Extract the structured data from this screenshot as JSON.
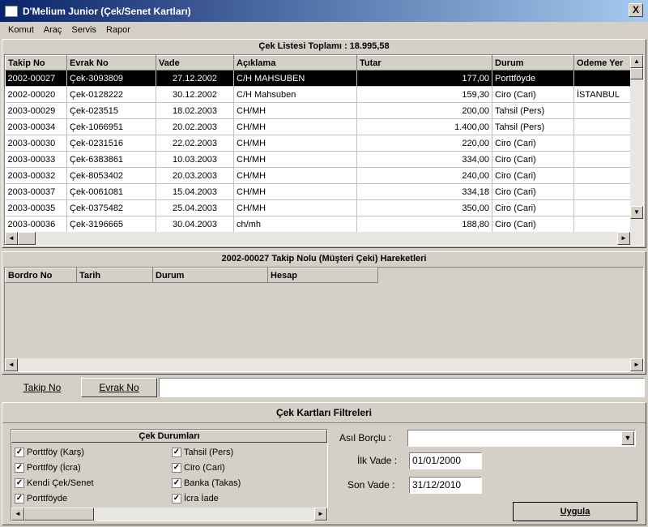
{
  "window": {
    "title": "D'Melium Junior (Çek/Senet Kartları)",
    "close": "X"
  },
  "menu": [
    "Komut",
    "Araç",
    "Servis",
    "Rapor"
  ],
  "list": {
    "title": "Çek Listesi Toplamı : 18.995,58",
    "columns": [
      "Takip No",
      "Evrak No",
      "Vade",
      "Açıklama",
      "Tutar",
      "Durum",
      "Odeme Yer"
    ],
    "rows": [
      [
        "2002-00027",
        "Çek-3093809",
        "27.12.2002",
        "C/H MAHSUBEN",
        "177,00",
        "Porttföyde",
        ""
      ],
      [
        "2002-00020",
        "Çek-0128222",
        "30.12.2002",
        "C/H Mahsuben",
        "159,30",
        "Ciro (Cari)",
        "İSTANBUL"
      ],
      [
        "2003-00029",
        "Çek-023515",
        "18.02.2003",
        "CH/MH",
        "200,00",
        "Tahsil (Pers)",
        ""
      ],
      [
        "2003-00034",
        "Çek-1066951",
        "20.02.2003",
        "CH/MH",
        "1.400,00",
        "Tahsil (Pers)",
        ""
      ],
      [
        "2003-00030",
        "Çek-0231516",
        "22.02.2003",
        "CH/MH",
        "220,00",
        "Ciro (Cari)",
        ""
      ],
      [
        "2003-00033",
        "Çek-6383861",
        "10.03.2003",
        "CH/MH",
        "334,00",
        "Ciro (Cari)",
        ""
      ],
      [
        "2003-00032",
        "Çek-8053402",
        "20.03.2003",
        "CH/MH",
        "240,00",
        "Ciro (Cari)",
        ""
      ],
      [
        "2003-00037",
        "Çek-0061081",
        "15.04.2003",
        "CH/MH",
        "334,18",
        "Ciro (Cari)",
        ""
      ],
      [
        "2003-00035",
        "Çek-0375482",
        "25.04.2003",
        "CH/MH",
        "350,00",
        "Ciro (Cari)",
        ""
      ],
      [
        "2003-00036",
        "Çek-3196665",
        "30.04.2003",
        "ch/mh",
        "188,80",
        "Ciro (Cari)",
        ""
      ]
    ]
  },
  "movements": {
    "title": "2002-00027 Takip Nolu (Müşteri Çeki) Hareketleri",
    "columns": [
      "Bordro No",
      "Tarih",
      "Durum",
      "Hesap"
    ]
  },
  "search": {
    "tab1": "Takip No",
    "tab2": "Evrak No",
    "value": ""
  },
  "filters": {
    "title": "Çek Kartları Filtreleri",
    "status_title": "Çek Durumları",
    "statuses_left": [
      "Porttföy (Karş)",
      "Porttföy (İcra)",
      "Kendi Çek/Senet",
      "Porttföyde"
    ],
    "statuses_right": [
      "Tahsil (Pers)",
      "Ciro (Cari)",
      "Banka (Takas)",
      "İcra İade"
    ],
    "asil_borclu_label": "Asıl Borçlu :",
    "asil_borclu_value": "",
    "ilk_vade_label": "İlk Vade :",
    "ilk_vade_value": "01/01/2000",
    "son_vade_label": "Son Vade :",
    "son_vade_value": "31/12/2010",
    "apply": "Uygula"
  }
}
